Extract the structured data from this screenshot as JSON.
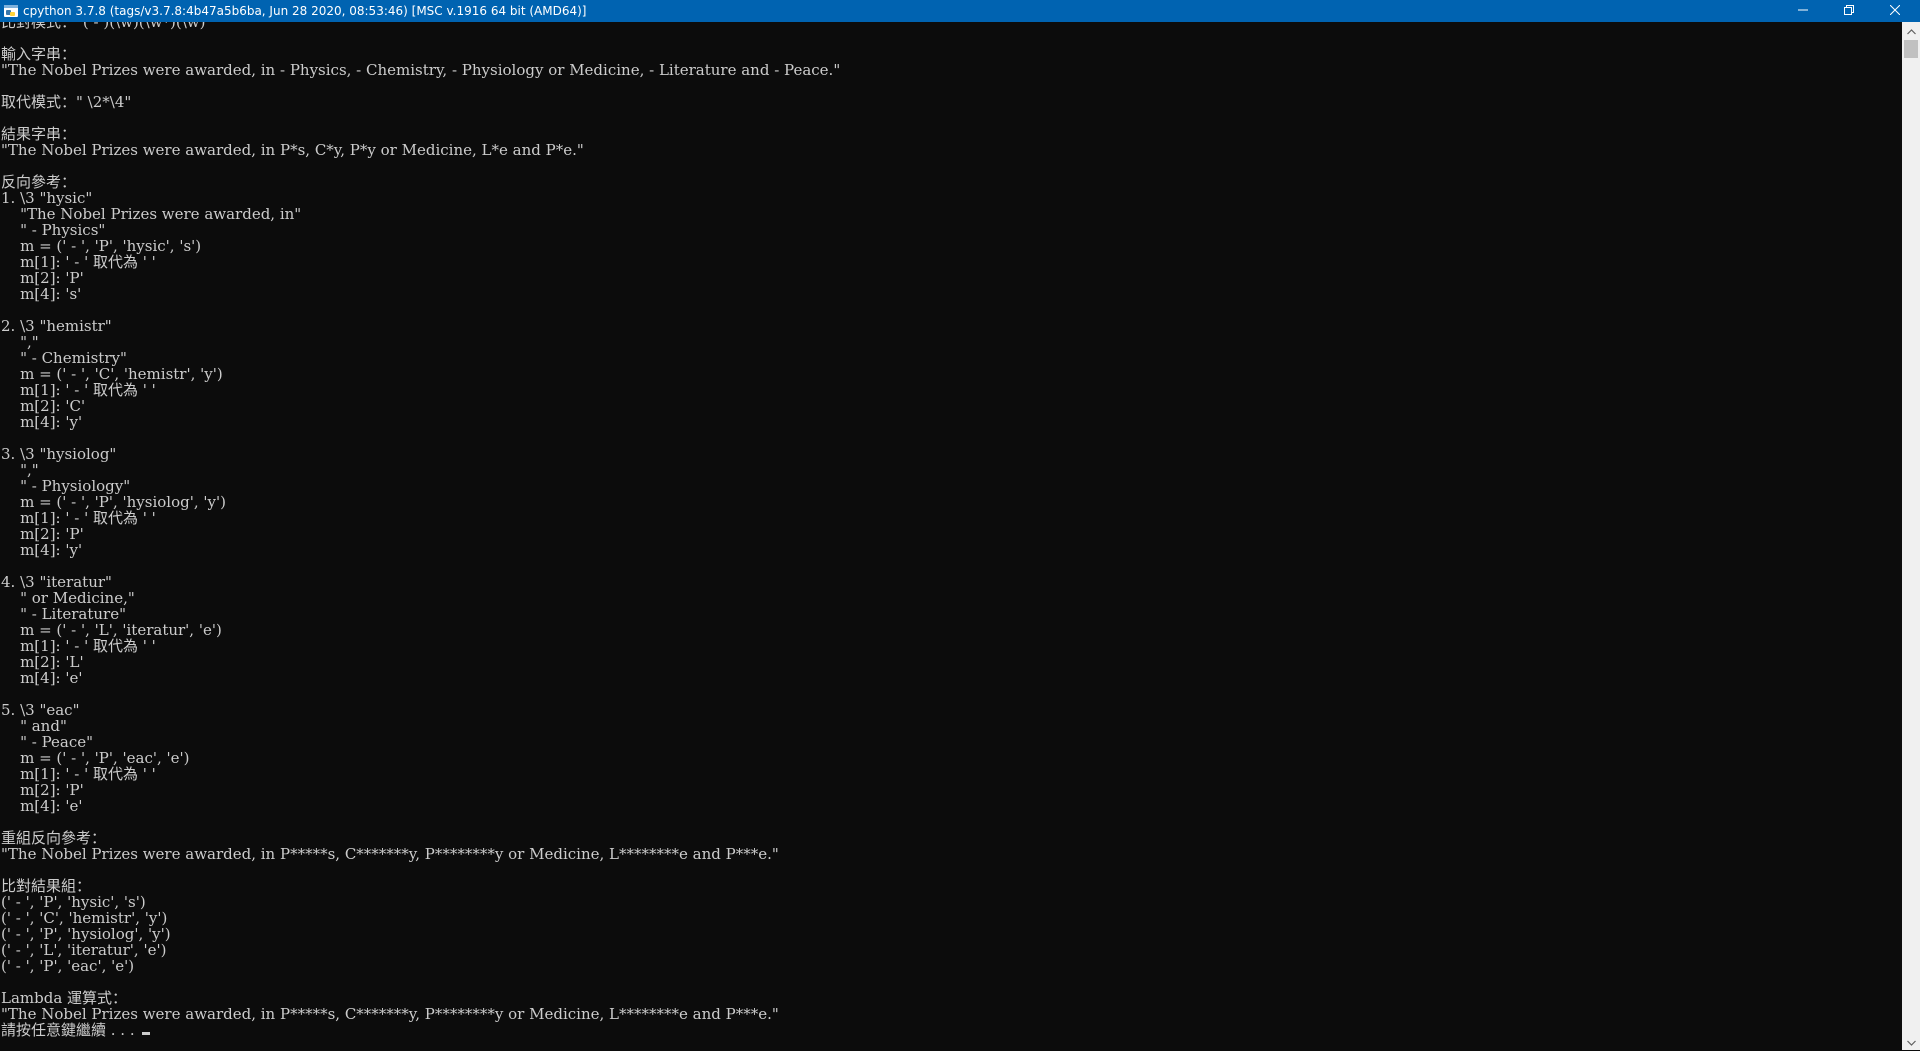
{
  "window": {
    "title": "cpython 3.7.8 (tags/v3.7.8:4b47a5b6ba, Jun 28 2020, 08:53:46) [MSC v.1916 64 bit (AMD64)]",
    "icons": {
      "app": "python-console-icon",
      "minimize": "minimize-icon",
      "maximize": "restore-icon",
      "close": "close-icon"
    },
    "colors": {
      "titlebar": "#0063b1",
      "console_bg": "#0c0c0c",
      "console_fg": "#cccccc"
    }
  },
  "console": {
    "lines": [
      "比對模式：\"( - )(\\w)(\\w*)(\\w)\"",
      "",
      "輸入字串：",
      "\"The Nobel Prizes were awarded, in - Physics, - Chemistry, - Physiology or Medicine, - Literature and - Peace.\"",
      "",
      "取代模式：\" \\2*\\4\"",
      "",
      "結果字串：",
      "\"The Nobel Prizes were awarded, in P*s, C*y, P*y or Medicine, L*e and P*e.\"",
      "",
      "反向參考：",
      "1. \\3 \"hysic\"",
      "    \"The Nobel Prizes were awarded, in\"",
      "    \" - Physics\"",
      "    m = (' - ', 'P', 'hysic', 's')",
      "    m[1]: ' - ' 取代為 ' '",
      "    m[2]: 'P'",
      "    m[4]: 's'",
      "",
      "2. \\3 \"hemistr\"",
      "    \",\"",
      "    \" - Chemistry\"",
      "    m = (' - ', 'C', 'hemistr', 'y')",
      "    m[1]: ' - ' 取代為 ' '",
      "    m[2]: 'C'",
      "    m[4]: 'y'",
      "",
      "3. \\3 \"hysiolog\"",
      "    \",\"",
      "    \" - Physiology\"",
      "    m = (' - ', 'P', 'hysiolog', 'y')",
      "    m[1]: ' - ' 取代為 ' '",
      "    m[2]: 'P'",
      "    m[4]: 'y'",
      "",
      "4. \\3 \"iteratur\"",
      "    \" or Medicine,\"",
      "    \" - Literature\"",
      "    m = (' - ', 'L', 'iteratur', 'e')",
      "    m[1]: ' - ' 取代為 ' '",
      "    m[2]: 'L'",
      "    m[4]: 'e'",
      "",
      "5. \\3 \"eac\"",
      "    \" and\"",
      "    \" - Peace\"",
      "    m = (' - ', 'P', 'eac', 'e')",
      "    m[1]: ' - ' 取代為 ' '",
      "    m[2]: 'P'",
      "    m[4]: 'e'",
      "",
      "重組反向參考：",
      "\"The Nobel Prizes were awarded, in P*****s, C*******y, P********y or Medicine, L********e and P***e.\"",
      "",
      "比對結果組：",
      "(' - ', 'P', 'hysic', 's')",
      "(' - ', 'C', 'hemistr', 'y')",
      "(' - ', 'P', 'hysiolog', 'y')",
      "(' - ', 'L', 'iteratur', 'e')",
      "(' - ', 'P', 'eac', 'e')",
      "",
      "Lambda 運算式：",
      "\"The Nobel Prizes were awarded, in P*****s, C*******y, P********y or Medicine, L********e and P***e.\""
    ],
    "prompt": "請按任意鍵繼續 . . . "
  }
}
